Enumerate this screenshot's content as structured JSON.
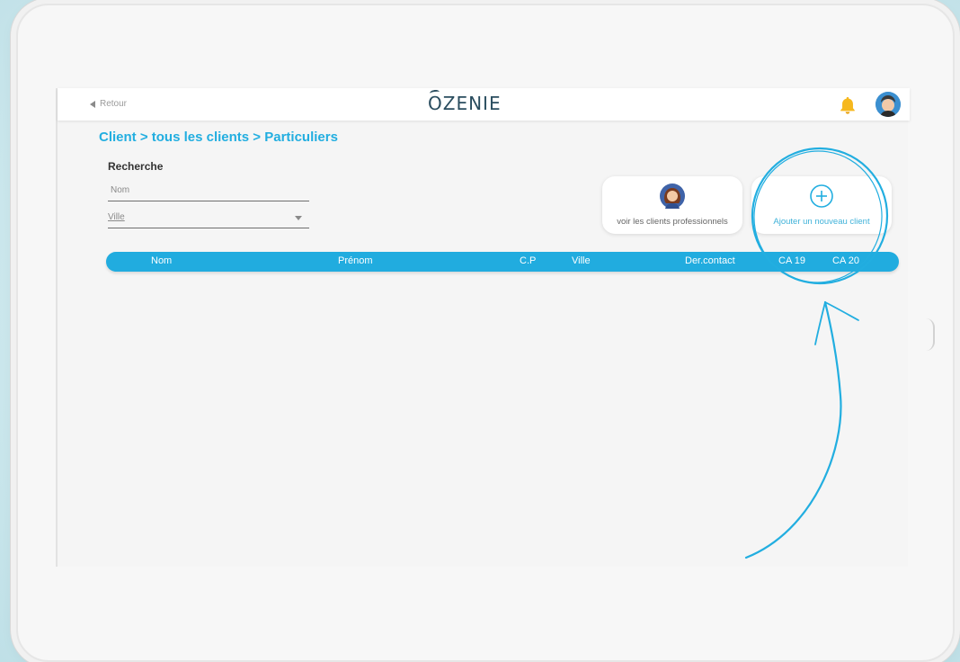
{
  "header": {
    "back_label": "Retour",
    "logo_text": "ZENIE",
    "logo_first": "O"
  },
  "breadcrumb": "Client > tous les clients > Particuliers",
  "search": {
    "title": "Recherche",
    "nom_placeholder": "Nom",
    "ville_placeholder": "Ville"
  },
  "actions": {
    "pro_label": "voir les clients professionnels",
    "new_label": "Ajouter un nouveau client"
  },
  "table": {
    "columns": [
      "Nom",
      "Prénom",
      "C.P",
      "Ville",
      "Der.contact",
      "CA 19",
      "CA 20"
    ]
  },
  "icons": {
    "back": "back-arrow-icon",
    "bell": "bell-icon",
    "avatar": "user-avatar",
    "pro": "professional-avatar-icon",
    "add": "plus-circle-icon",
    "expand": "double-chevron-right-icon"
  },
  "colors": {
    "accent": "#21acdf",
    "breadcrumb": "#22aee0",
    "bell": "#f6b81e",
    "annotation": "#22aee0"
  }
}
